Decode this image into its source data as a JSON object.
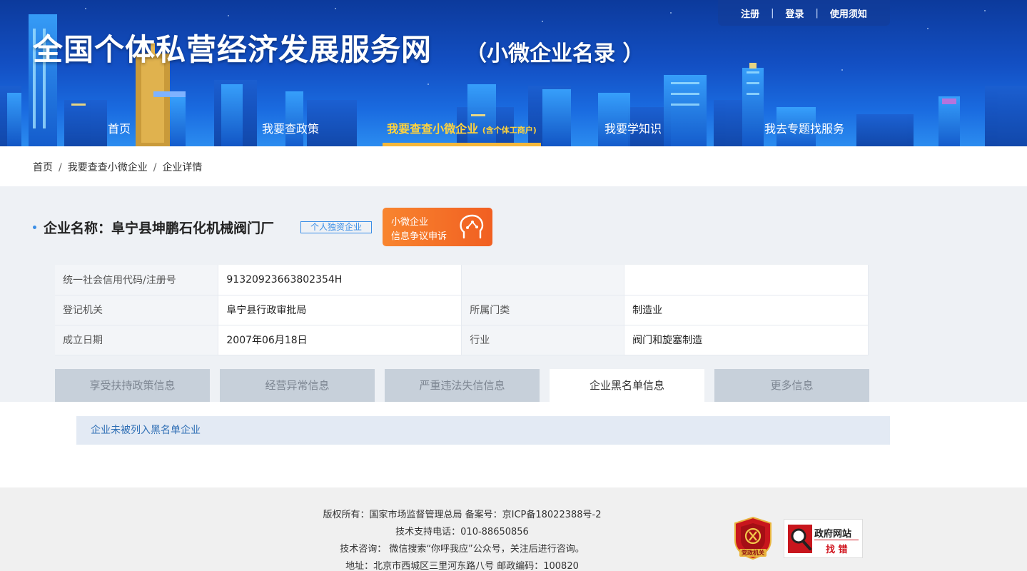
{
  "header": {
    "title": "全国个体私营经济发展服务网",
    "subtitle": "（小微企业名录 ）",
    "top_links": [
      "注册",
      "登录",
      "使用须知"
    ]
  },
  "nav": {
    "items": [
      {
        "label": "首页"
      },
      {
        "label": "我要查政策"
      },
      {
        "label": "我要查查小微企业",
        "note": "(含个体工商户)"
      },
      {
        "label": "我要学知识"
      },
      {
        "label": "我去专题找服务"
      }
    ],
    "active_index": 2
  },
  "breadcrumb": [
    "首页",
    "我要查查小微企业",
    "企业详情"
  ],
  "enterprise": {
    "name_label": "企业名称：",
    "name": "阜宁县坤鹏石化机械阀门厂",
    "type_tag": "个人独资企业",
    "dispute_line1": "小微企业",
    "dispute_line2": "信息争议申诉"
  },
  "info_table": {
    "rows": [
      {
        "label1": "统一社会信用代码/注册号",
        "value1": "91320923663802354H",
        "label2": "",
        "value2": ""
      },
      {
        "label1": "登记机关",
        "value1": "阜宁县行政审批局",
        "label2": "所属门类",
        "value2": "制造业"
      },
      {
        "label1": "成立日期",
        "value1": "2007年06月18日",
        "label2": "行业",
        "value2": "阀门和旋塞制造"
      }
    ]
  },
  "tabs": {
    "items": [
      "享受扶持政策信息",
      "经营异常信息",
      "严重违法失信信息",
      "企业黑名单信息",
      "更多信息"
    ],
    "active_index": 3
  },
  "blacklist_result": "企业未被列入黑名单企业",
  "footer": {
    "line1": "版权所有：国家市场监督管理总局 备案号：京ICP备18022388号-2",
    "line2": "技术支持电话：010-88650856",
    "line3": "技术咨询： 微信搜索“你呼我应”公众号，关注后进行咨询。",
    "line4": "地址：北京市西城区三里河东路八号 邮政编码：100820",
    "badge_party_text": "党政机关",
    "badge_gov_line1": "政府网站",
    "badge_gov_line2": "找 错"
  },
  "colors": {
    "accent_blue": "#3a8ee6",
    "nav_active": "#ffd23c",
    "dispute_orange": "#f15f21",
    "badge_red": "#d0141e"
  }
}
